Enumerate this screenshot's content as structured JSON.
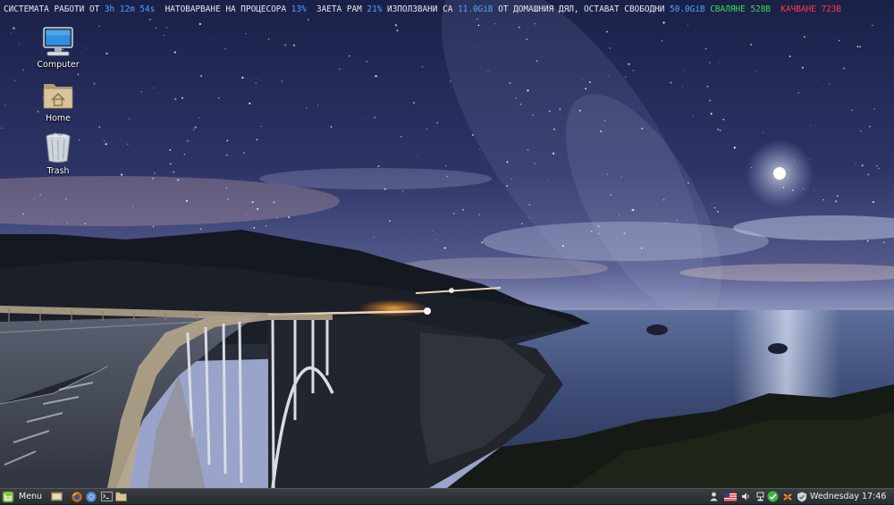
{
  "conky": {
    "uptime_label": "СИСТЕМАТА РАБОТИ ОТ ",
    "uptime_value": "3h 12m 54s",
    "cpu_label": "  НАТОВАРВАНЕ НА ПРОЦЕСОРА ",
    "cpu_value": "13%",
    "ram_label": "  ЗАЕТА РАМ ",
    "ram_value": "21%",
    "used_label": " ИЗПОЛЗВАНИ СА ",
    "used_value": "11.0GiB",
    "home_label": " ОТ ДОМАШНИЯ ДЯЛ, ОСТАВАТ СВОБОДНИ ",
    "free_value": "50.0GiB",
    "down_label": " СВАЛЯНЕ ",
    "down_value": "528B",
    "up_label": "  КАЧВАНЕ ",
    "up_value": "723B",
    "colors": {
      "text": "#e6e9f0",
      "value": "#4aa8ff",
      "down": "#35e04a",
      "up": "#ff3b3b"
    }
  },
  "desktop": {
    "icons": [
      {
        "label": "Computer",
        "icon": "computer-icon"
      },
      {
        "label": "Home",
        "icon": "home-folder-icon"
      },
      {
        "label": "Trash",
        "icon": "trash-icon"
      }
    ]
  },
  "taskbar": {
    "menu_label": "Menu",
    "launchers": [
      "show-desktop-icon",
      "firefox-icon",
      "chromium-icon",
      "terminal-icon",
      "files-icon"
    ],
    "tray": [
      "user-icon",
      "keyboard-layout-us-flag-icon",
      "volume-icon",
      "network-icon",
      "update-manager-icon",
      "bluetooth-icon",
      "shield-icon"
    ],
    "clock": "Wednesday 17:46",
    "colors": {
      "mint": "#86be43",
      "panel": "#2f3134"
    }
  }
}
